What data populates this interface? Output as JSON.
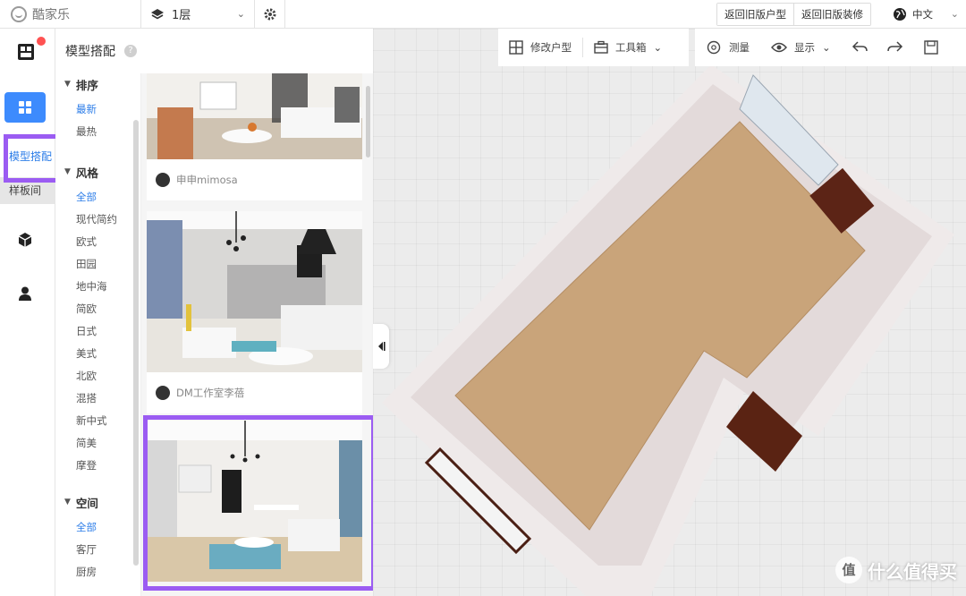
{
  "app": {
    "logo_text": "酷家乐",
    "floor_label": "1层",
    "old_floorplan_btn": "返回旧版户型",
    "old_decor_btn": "返回旧版装修",
    "language": "中文"
  },
  "iconbar": {
    "sub_items": [
      "模型搭配",
      "样板间"
    ]
  },
  "panel": {
    "title": "模型搭配",
    "sections": [
      {
        "title": "排序",
        "items": [
          "最新",
          "最热"
        ],
        "active": 0
      },
      {
        "title": "风格",
        "items": [
          "全部",
          "现代简约",
          "欧式",
          "田园",
          "地中海",
          "简欧",
          "日式",
          "美式",
          "北欧",
          "混搭",
          "新中式",
          "简美",
          "摩登"
        ],
        "active": 0
      },
      {
        "title": "空间",
        "items": [
          "全部",
          "客厅",
          "厨房"
        ],
        "active": 0
      }
    ],
    "cards": [
      {
        "author": "申申mimosa"
      },
      {
        "author": "DM工作室李蓓"
      },
      {
        "author": ""
      }
    ]
  },
  "toolbar": {
    "modify_floorplan": "修改户型",
    "toolbox": "工具箱",
    "measure": "测量",
    "display": "显示"
  },
  "watermark": {
    "icon_text": "值",
    "text": "什么值得买"
  },
  "colors": {
    "accent": "#3d8bfd",
    "highlight": "#9b5cf2",
    "notification": "#ff5252",
    "floor": "#c9a47a"
  }
}
